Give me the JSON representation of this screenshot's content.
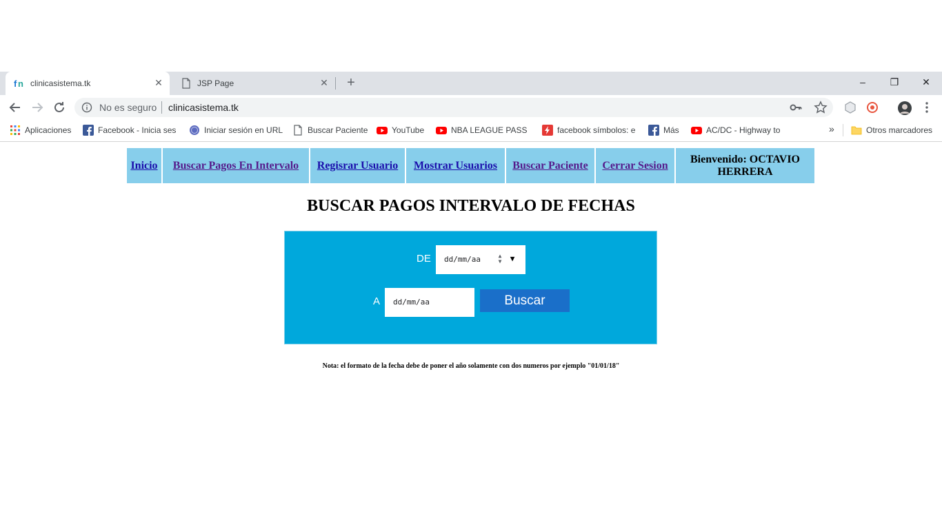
{
  "browser": {
    "tabs": [
      {
        "title": "clinicasistema.tk",
        "active": true
      },
      {
        "title": "JSP Page",
        "active": false
      }
    ],
    "new_tab_symbol": "+",
    "window_controls": {
      "minimize": "–",
      "restore": "❐",
      "close": "✕"
    },
    "address": {
      "security_label": "No es seguro",
      "url": "clinicasistema.tk"
    },
    "bookmarks": [
      {
        "label": "Aplicaciones",
        "icon": "apps-grid-icon"
      },
      {
        "label": "Facebook - Inicia sesi",
        "icon": "facebook-icon"
      },
      {
        "label": "Iniciar sesión en URL",
        "icon": "seal-icon"
      },
      {
        "label": "Buscar Paciente",
        "icon": "page-icon"
      },
      {
        "label": "YouTube",
        "icon": "youtube-icon"
      },
      {
        "label": "NBA LEAGUE PASS H",
        "icon": "youtube-icon"
      },
      {
        "label": "facebook símbolos: e",
        "icon": "lightning-icon"
      },
      {
        "label": "Más",
        "icon": "facebook-icon"
      },
      {
        "label": "AC/DC - Highway to",
        "icon": "youtube-icon"
      }
    ],
    "bookmarks_overflow": "»",
    "other_bookmarks": "Otros marcadores"
  },
  "page": {
    "nav": [
      {
        "label": "Inicio",
        "link": true
      },
      {
        "label": "Buscar Pagos En Intervalo",
        "link": true
      },
      {
        "label": "Regisrar Usuario",
        "link": true
      },
      {
        "label": "Mostrar Usuarios",
        "link": true
      },
      {
        "label": "Buscar Paciente",
        "link": true
      },
      {
        "label": "Cerrar Sesion",
        "link": true
      },
      {
        "label": "Bienvenido: OCTAVIO HERRERA",
        "link": false
      }
    ],
    "heading": "BUSCAR PAGOS INTERVALO DE FECHAS",
    "form": {
      "from_label": "DE",
      "from_placeholder": "dd/mm/aa",
      "to_label": "A",
      "to_placeholder": "dd/mm/aa",
      "submit_label": "Buscar"
    },
    "note": "Nota: el formato de la fecha debe de poner el año solamente con dos numeros por ejemplo \"01/01/18\""
  },
  "colors": {
    "nav_bg": "#87ceeb",
    "form_bg": "#00a8dc",
    "button_bg": "#1a6fc9",
    "link": "#1a0dab",
    "visited_link": "#551a8b"
  }
}
